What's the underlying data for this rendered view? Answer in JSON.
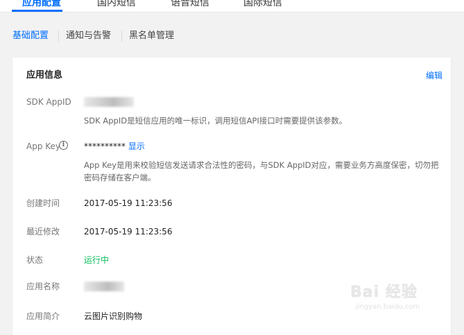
{
  "top_tabs": [
    {
      "label": "应用配置",
      "active": true
    },
    {
      "label": "国内短信",
      "active": false
    },
    {
      "label": "语音短信",
      "active": false
    },
    {
      "label": "国际短信",
      "active": false
    }
  ],
  "sub_tabs": [
    {
      "label": "基础配置",
      "active": true
    },
    {
      "label": "通知与告警",
      "active": false
    },
    {
      "label": "黑名单管理",
      "active": false
    }
  ],
  "card": {
    "title": "应用信息",
    "edit_label": "编辑",
    "fields": {
      "sdk_appid": {
        "label": "SDK AppID",
        "desc": "SDK AppID是短信应用的唯一标识，调用短信API接口时需要提供该参数。"
      },
      "app_key": {
        "label": "App Key",
        "value": "**********",
        "show_label": "显示",
        "desc": "App Key是用来校验短信发送请求合法性的密码，与SDK AppID对应，需要业务方高度保密，切勿把密码存储在客户端。"
      },
      "created": {
        "label": "创建时间",
        "value": "2017-05-19 11:23:56"
      },
      "modified": {
        "label": "最近修改",
        "value": "2017-05-19 11:23:56"
      },
      "status": {
        "label": "状态",
        "value": "运行中"
      },
      "app_name": {
        "label": "应用名称"
      },
      "app_intro": {
        "label": "应用简介",
        "value": "云图片识别购物"
      }
    }
  },
  "watermark": {
    "text": "Bai 经验",
    "url": "jingyan.baidu.com"
  },
  "colors": {
    "accent": "#006eff",
    "status_running": "#0abf5b"
  },
  "icons": {
    "info": "info-circle-icon"
  }
}
